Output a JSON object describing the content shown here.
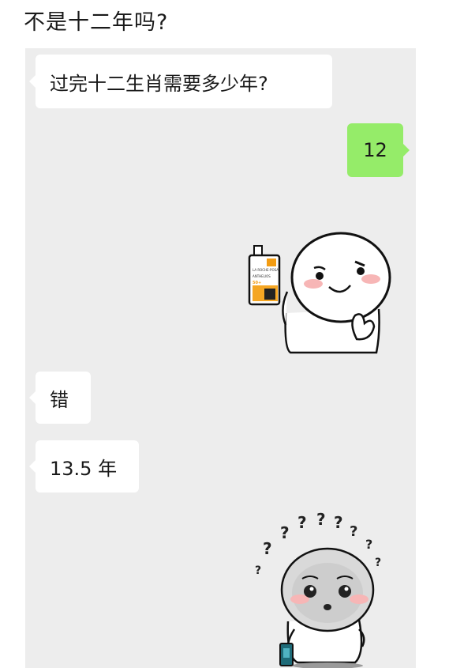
{
  "post": {
    "caption": "不是十二年吗?"
  },
  "chat": {
    "messages": [
      {
        "side": "left",
        "type": "text",
        "text": "过完十二生肖需要多少年?"
      },
      {
        "side": "right",
        "type": "text",
        "text": "12"
      },
      {
        "side": "right",
        "type": "sticker",
        "sticker": "bun-character-holding-sunscreen"
      },
      {
        "side": "left",
        "type": "text",
        "text": "错"
      },
      {
        "side": "left",
        "type": "text",
        "text": "13.5 年"
      },
      {
        "side": "right",
        "type": "sticker",
        "sticker": "bun-character-confused-question-marks"
      }
    ]
  },
  "sticker1": {
    "bottle_lines": [
      "LA ROCHE-POSAY",
      "ANTHELIOS",
      "50+"
    ]
  },
  "colors": {
    "chat_background": "#ededed",
    "incoming_bubble": "#ffffff",
    "outgoing_bubble": "#95ec69",
    "blush": "#f7b6b6"
  }
}
